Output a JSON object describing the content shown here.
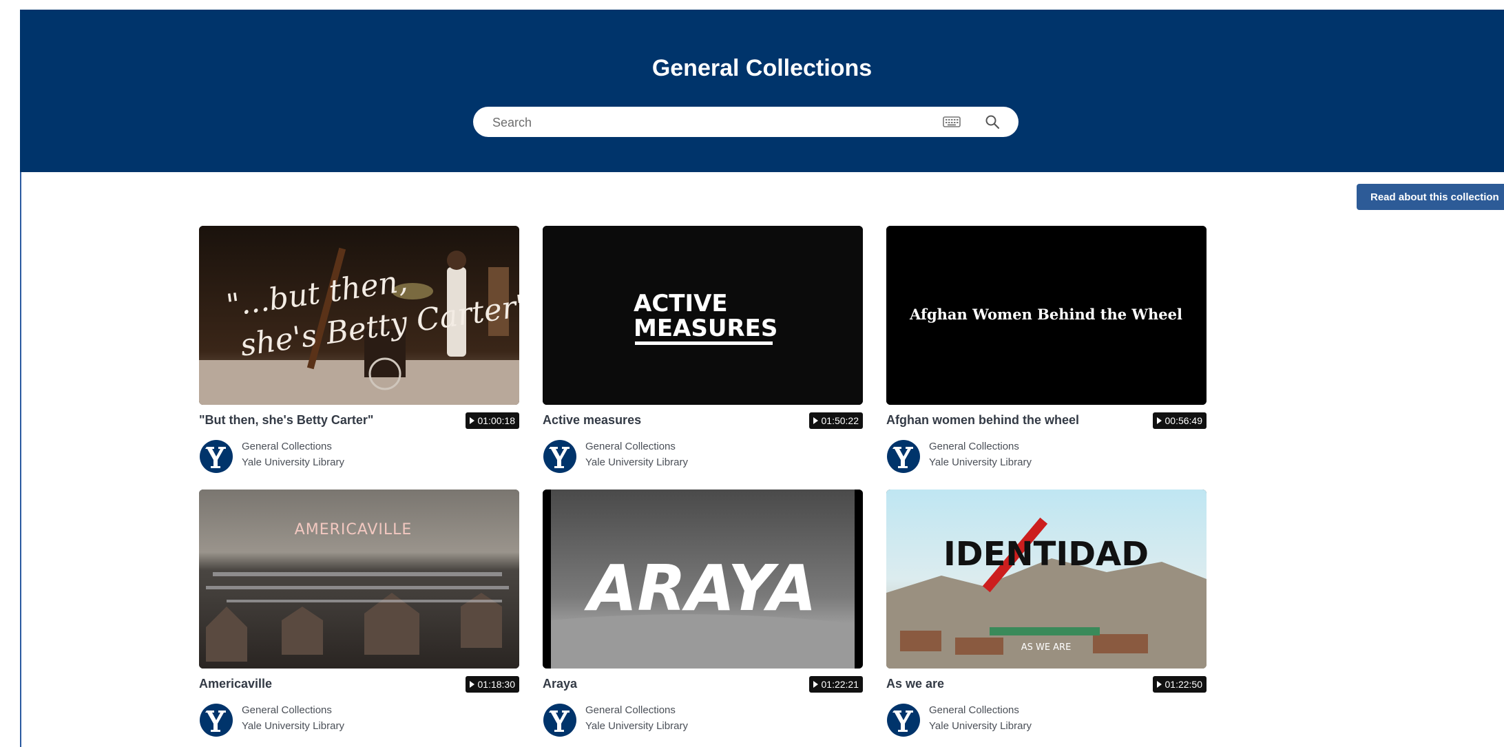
{
  "header": {
    "title": "General Collections",
    "search_placeholder": "Search",
    "keyboard_icon": "keyboard-icon",
    "search_icon": "search-icon"
  },
  "about_button": {
    "label": "Read about this collection"
  },
  "colors": {
    "banner": "#00346b",
    "button": "#2d5b97"
  },
  "items": [
    {
      "title": "\"But then, she's Betty Carter\"",
      "duration": "01:00:18",
      "collection": "General Collections",
      "library": "Yale University Library",
      "thumb_text": "\"...but then, she's Betty Carter\""
    },
    {
      "title": "Active measures",
      "duration": "01:50:22",
      "collection": "General Collections",
      "library": "Yale University Library",
      "thumb_text_1": "ACTIVE",
      "thumb_text_2": "MEASURES"
    },
    {
      "title": "Afghan women behind the wheel",
      "duration": "00:56:49",
      "collection": "General Collections",
      "library": "Yale University Library",
      "thumb_text": "Afghan Women Behind the Wheel"
    },
    {
      "title": "Americaville",
      "duration": "01:18:30",
      "collection": "General Collections",
      "library": "Yale University Library",
      "thumb_text": "AMERICAVILLE"
    },
    {
      "title": "Araya",
      "duration": "01:22:21",
      "collection": "General Collections",
      "library": "Yale University Library",
      "thumb_text": "ARAYA"
    },
    {
      "title": "As we are",
      "duration": "01:22:50",
      "collection": "General Collections",
      "library": "Yale University Library",
      "thumb_text": "IDENTIDAD",
      "thumb_subtext": "AS WE ARE"
    }
  ]
}
